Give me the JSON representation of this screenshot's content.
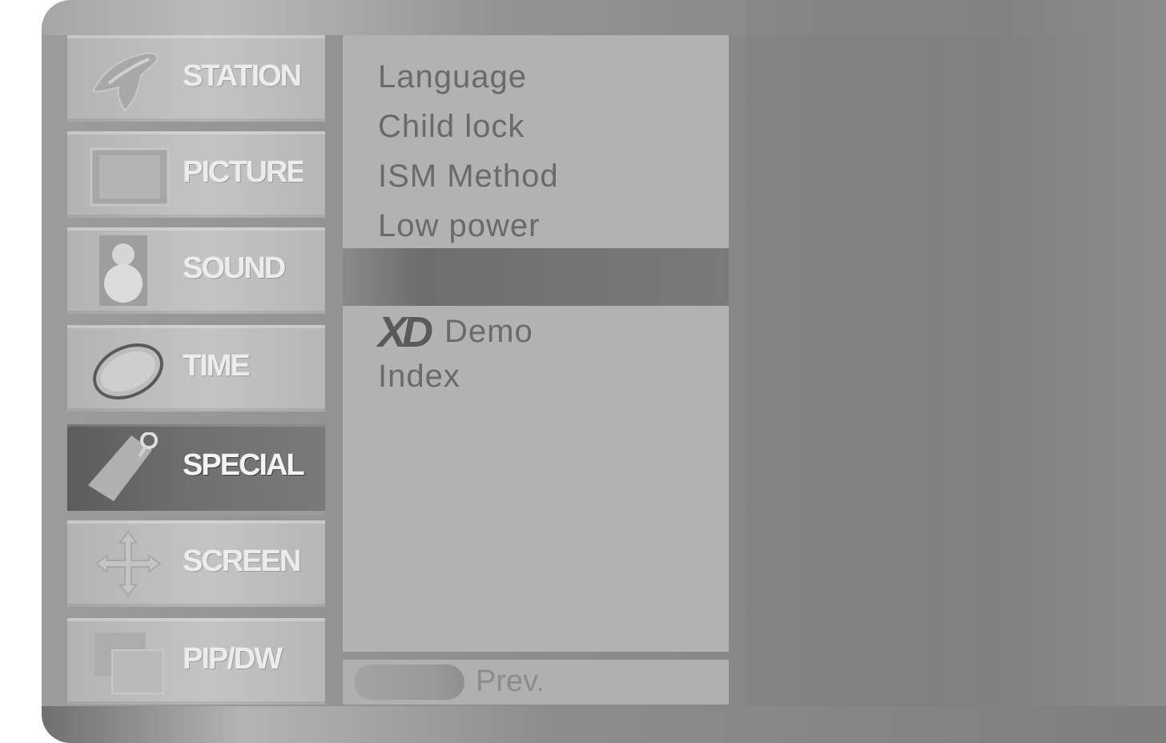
{
  "sidebar": {
    "items": [
      {
        "label": "STATION",
        "icon": "satellite-icon",
        "active": false
      },
      {
        "label": "PICTURE",
        "icon": "tv-screen-icon",
        "active": false
      },
      {
        "label": "SOUND",
        "icon": "speaker-icon",
        "active": false
      },
      {
        "label": "TIME",
        "icon": "orbit-clock-icon",
        "active": false
      },
      {
        "label": "SPECIAL",
        "icon": "tag-icon",
        "active": true
      },
      {
        "label": "SCREEN",
        "icon": "move-arrows-icon",
        "active": false
      },
      {
        "label": "PIP/DW",
        "icon": "pip-windows-icon",
        "active": false
      }
    ]
  },
  "submenu": {
    "top_items": [
      "Language",
      "Child lock",
      "ISM Method",
      "Low power"
    ],
    "xd_logo": "XD",
    "xd_demo_label": "Demo",
    "index_label": "Index"
  },
  "footer": {
    "prev_label": "Prev."
  }
}
